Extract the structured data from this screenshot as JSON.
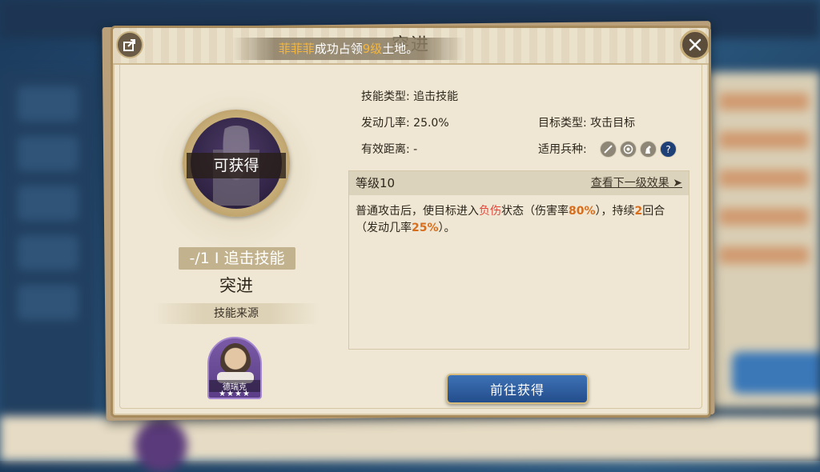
{
  "dialog": {
    "title": "突进"
  },
  "banner": {
    "player_name": "菲菲菲",
    "text_1": "成功占领",
    "land_level": "9级",
    "text_2": "土地。"
  },
  "skill_card": {
    "status_label": "可获得",
    "tag": "-/1 I 追击技能",
    "name": "突进",
    "source_title": "技能来源",
    "hero": {
      "name": "德瑞克",
      "stars": "★★★★"
    }
  },
  "details": {
    "skill_type": "技能类型: 追击技能",
    "trigger_rate": "发动几率: 25.0%",
    "effective_range": "有效距离: -",
    "target_type": "目标类型: 攻击目标",
    "unit_types_label": "适用兵种:",
    "unit_icons": [
      "sword-icon",
      "target-icon",
      "horse-icon",
      "question-icon"
    ]
  },
  "level_section": {
    "level": "等级10",
    "next_level_link": "查看下一级效果 ➤"
  },
  "description": {
    "p1": "普通攻击后，使目标进入",
    "status": "负伤",
    "p2": "状态（伤害率",
    "damage_rate": "80%",
    "p3": "），持续",
    "turns": "2",
    "p4": "回合（发动几率",
    "chance": "25%",
    "p5": "）。"
  },
  "actions": {
    "go_obtain": "前往获得"
  },
  "colors": {
    "highlight_gold": "#f3b640",
    "status_red": "#e0473b",
    "value_orange": "#d66e1d",
    "button_blue": "#2e5ea0"
  }
}
